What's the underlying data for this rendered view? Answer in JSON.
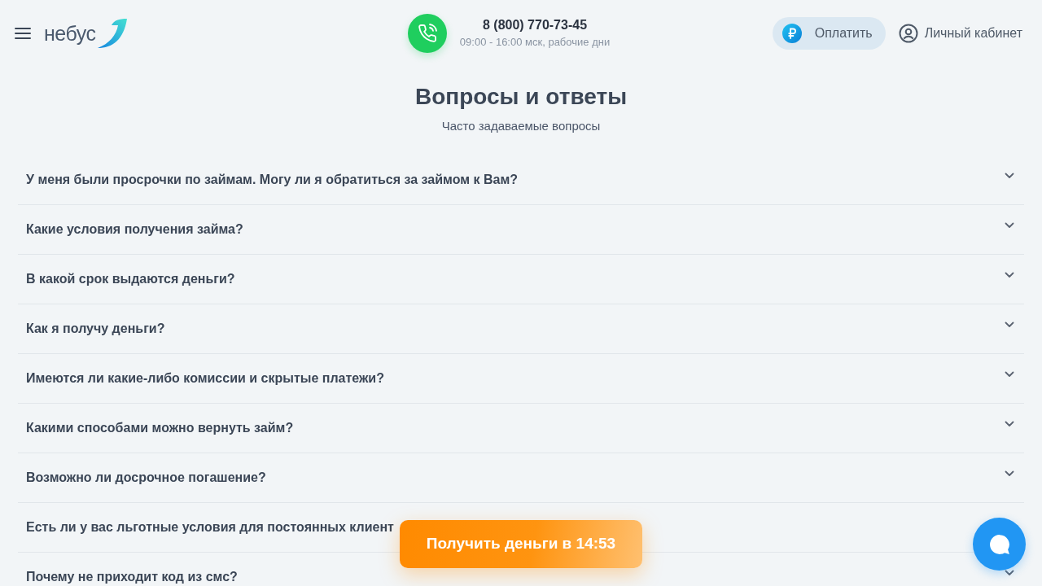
{
  "header": {
    "logo": {
      "text": "небус"
    },
    "phone": {
      "number": "8 (800) 770-73-45",
      "hours": "09:00 - 16:00 мск, рабочие дни"
    },
    "pay_button": {
      "label": "Оплатить"
    },
    "account_link": {
      "label": "Личный кабинет"
    }
  },
  "faq": {
    "title": "Вопросы и ответы",
    "subtitle": "Часто задаваемые вопросы",
    "items": [
      {
        "question": "У меня были просрочки по займам. Могу ли я обратиться за займом к Вам?",
        "expanded": false
      },
      {
        "question": "Какие условия получения займа?",
        "expanded": false
      },
      {
        "question": "В какой срок выдаются деньги?",
        "expanded": false
      },
      {
        "question": "Как я получу деньги?",
        "expanded": false
      },
      {
        "question": "Имеются ли какие-либо комиссии и скрытые платежи?",
        "expanded": false
      },
      {
        "question": "Какими способами можно вернуть займ?",
        "expanded": false
      },
      {
        "question": "Возможно ли досрочное погашение?",
        "expanded": false
      },
      {
        "question": "Есть ли у вас льготные условия для постоянных клиент"
      },
      {
        "question": "Почему не приходит код из смс?",
        "expanded": false
      }
    ]
  },
  "cta_button": {
    "label": "Получить деньги в 14:53"
  }
}
